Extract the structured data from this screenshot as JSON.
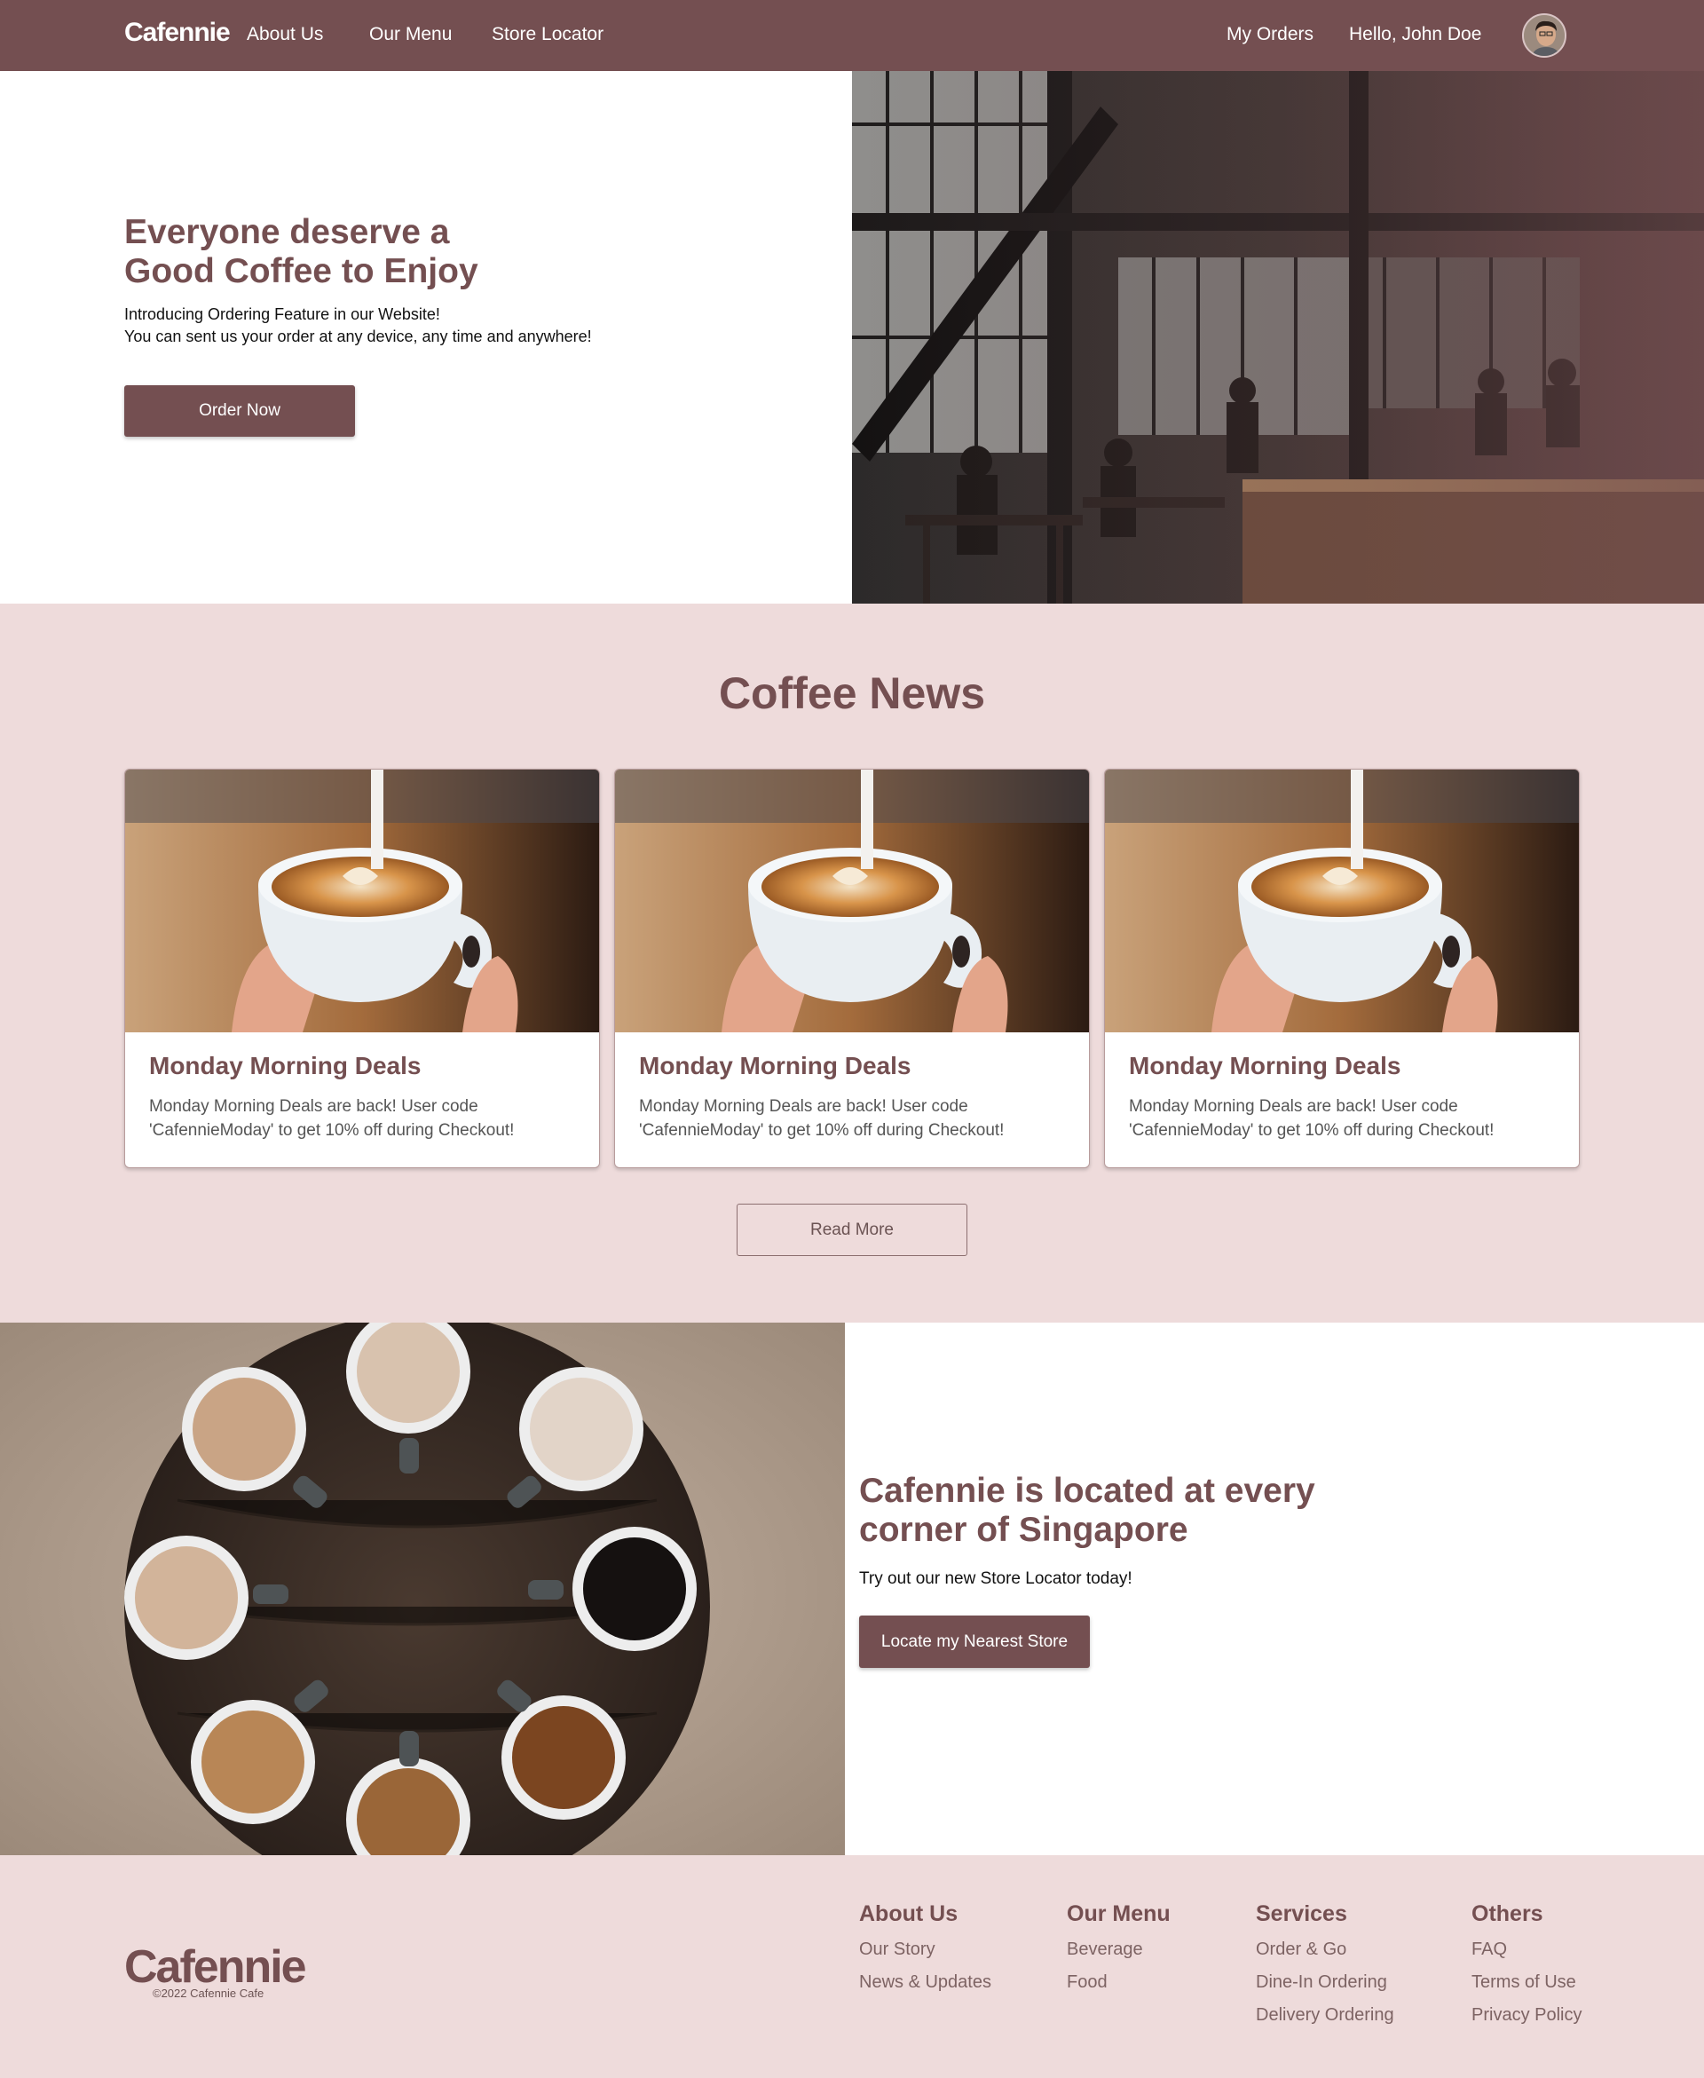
{
  "nav": {
    "logo": "Cafennie",
    "links": [
      "About Us",
      "Our Menu",
      "Store Locator"
    ],
    "my_orders": "My Orders",
    "greeting": "Hello, John Doe"
  },
  "hero": {
    "title_line1": "Everyone deserve a",
    "title_line2": "Good Coffee to Enjoy",
    "sub_line1": "Introducing Ordering Feature in our Website!",
    "sub_line2": "You can sent us your order at any device, any time and anywhere!",
    "cta": "Order Now"
  },
  "news": {
    "title": "Coffee News",
    "cards": [
      {
        "title": "Monday Morning Deals",
        "text": "Monday Morning Deals are back! User code 'CafennieModay' to get 10% off during Checkout!"
      },
      {
        "title": "Monday Morning Deals",
        "text": "Monday Morning Deals are back! User code 'CafennieModay' to get 10% off during Checkout!"
      },
      {
        "title": "Monday Morning Deals",
        "text": "Monday Morning Deals are back! User code 'CafennieModay' to get 10% off during Checkout!"
      }
    ],
    "read_more": "Read More"
  },
  "location": {
    "title_line1": "Cafennie is located at every",
    "title_line2": "corner of Singapore",
    "sub": "Try out our new Store Locator today!",
    "cta": "Locate my Nearest Store"
  },
  "footer": {
    "logo": "Cafennie",
    "copyright": "©2022 Cafennie Cafe",
    "columns": [
      {
        "heading": "About Us",
        "items": [
          "Our Story",
          "News & Updates"
        ]
      },
      {
        "heading": "Our Menu",
        "items": [
          "Beverage",
          "Food"
        ]
      },
      {
        "heading": "Services",
        "items": [
          "Order & Go",
          "Dine-In Ordering",
          "Delivery Ordering"
        ]
      },
      {
        "heading": "Others",
        "items": [
          "FAQ",
          "Terms of Use",
          "Privacy Policy"
        ]
      }
    ]
  },
  "colors": {
    "brand": "#744f51",
    "section_bg": "#eedbdb"
  }
}
